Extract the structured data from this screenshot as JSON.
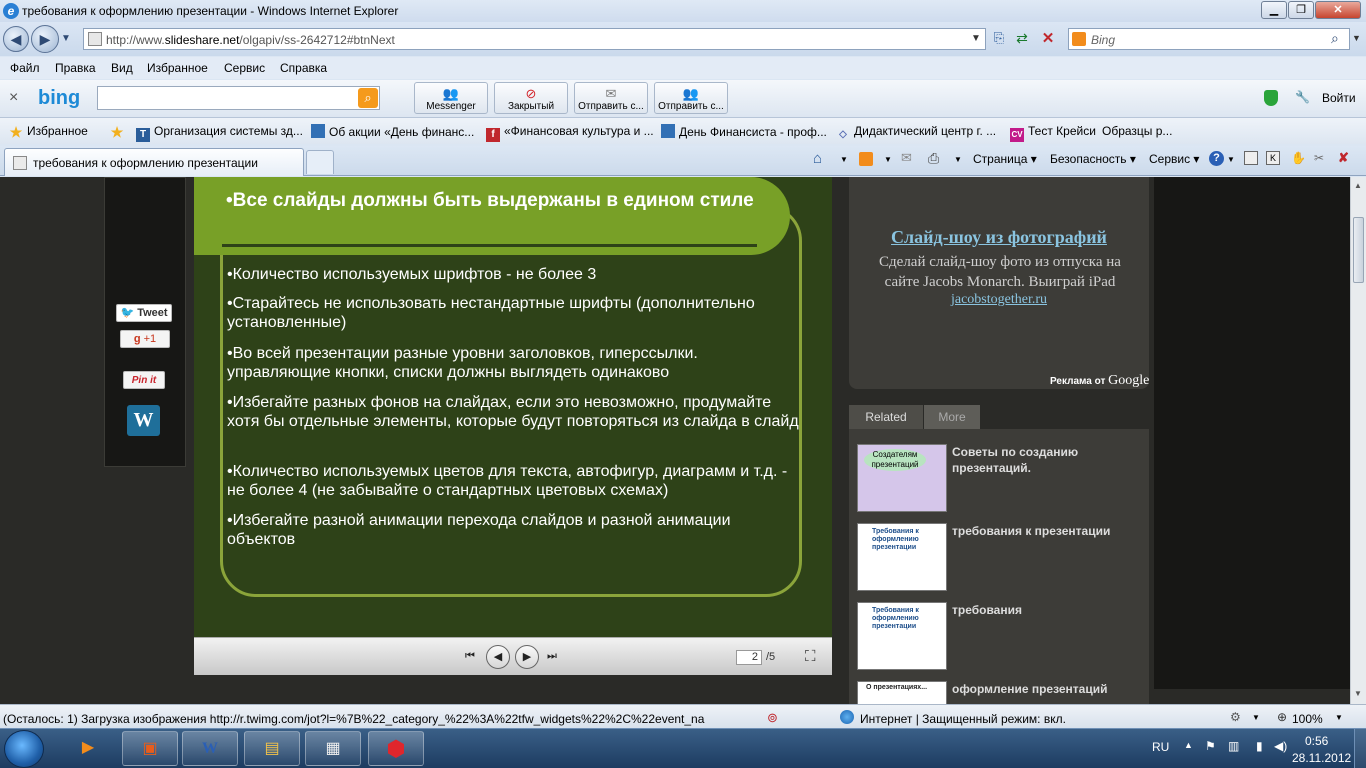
{
  "window": {
    "title": "требования к оформлению презентации - Windows Internet Explorer",
    "btn_min": "▁",
    "btn_max": "❐",
    "btn_close": "✕"
  },
  "address": {
    "prefix": "http://www.",
    "domain": "slideshare.net",
    "suffix": "/olgapiv/ss-2642712#btnNext",
    "search_placeholder": "Bing"
  },
  "menu": [
    "Файл",
    "Правка",
    "Вид",
    "Избранное",
    "Сервис",
    "Справка"
  ],
  "bing_toolbar": {
    "logo": "bing",
    "buttons": [
      {
        "label": "Messenger",
        "icon": "messenger-icon"
      },
      {
        "label": "Закрытый",
        "icon": "block-icon"
      },
      {
        "label": "Отправить с...",
        "icon": "mail-icon"
      },
      {
        "label": "Отправить с...",
        "icon": "messenger-icon"
      }
    ],
    "signin": "Войти"
  },
  "favorites": {
    "label": "Избранное",
    "items": [
      {
        "label": "Организация системы зд...",
        "icon": "T",
        "color": "#2a5d9a"
      },
      {
        "label": "Об акции «День финанс...",
        "icon": "Дф",
        "color": "#3270b5"
      },
      {
        "label": "«Финансовая культура и ...",
        "icon": "f",
        "color": "#c0272d"
      },
      {
        "label": "День Финансиста - проф...",
        "icon": "Дф",
        "color": "#3270b5"
      },
      {
        "label": "Дидактический центр г. ...",
        "icon": "◇",
        "color": "#5a6fb5"
      },
      {
        "label": "Тест Крейси",
        "icon": "CV",
        "color": "#c21a8a"
      },
      {
        "label": "Образцы р...",
        "icon": "",
        "color": ""
      }
    ]
  },
  "tab": {
    "label": "требования к оформлению презентации"
  },
  "commandbar": [
    "Страница",
    "Безопасность",
    "Сервис"
  ],
  "share": {
    "tweet": "Tweet",
    "gplus": "+1",
    "pinit": "Pin it",
    "wordpress": "W"
  },
  "slide": {
    "title": "•Все слайды должны быть выдержаны в едином стиле",
    "bullets": [
      "•Количество используемых шрифтов - не более 3",
      "•Старайтесь не использовать нестандартные шрифты (дополнительно установленные)",
      "•Во всей презентации разные уровни заголовков, гиперссылки. управляющие кнопки, списки должны выглядеть одинаково",
      "•Избегайте разных фонов на слайдах, если это невозможно, продумайте хотя бы отдельные элементы, которые будут повторяться из слайда в слайд",
      "•Количество используемых цветов для текста, автофигур, диаграмм и т.д. - не более 4 (не забывайте о стандартных цветовых схемах)",
      "•Избегайте разной анимации перехода слайдов и разной анимации объектов"
    ],
    "page_current": "2",
    "page_total": "/5"
  },
  "ad": {
    "title": "Слайд-шоу из фотографий",
    "text": "Сделай слайд-шоу фото из отпуска на сайте Jacobs Monarch. Выиграй iPad",
    "link": "jacobstogether.ru",
    "label_prefix": "Реклама от",
    "label_brand": "Google"
  },
  "related": {
    "tabs": [
      "Related",
      "More"
    ],
    "items": [
      {
        "title": "Советы по созданию презентаций.",
        "thumb_text": "Создателям презентаций"
      },
      {
        "title": "требования к презентации",
        "thumb_text": "Требования к оформлению презентации"
      },
      {
        "title": "требования",
        "thumb_text": "Требования к оформлению презентации"
      },
      {
        "title": "оформление презентаций",
        "thumb_text": "О презентациях..."
      }
    ]
  },
  "status": {
    "loading": "(Осталось: 1) Загрузка изображения http://r.twimg.com/jot?l=%7B%22_category_%22%3A%22tfw_widgets%22%2C%22event_na",
    "zone": "Интернет | Защищенный режим: вкл.",
    "zoom": "100%"
  },
  "taskbar": {
    "lang": "RU",
    "time": "0:56",
    "date": "28.11.2012"
  }
}
